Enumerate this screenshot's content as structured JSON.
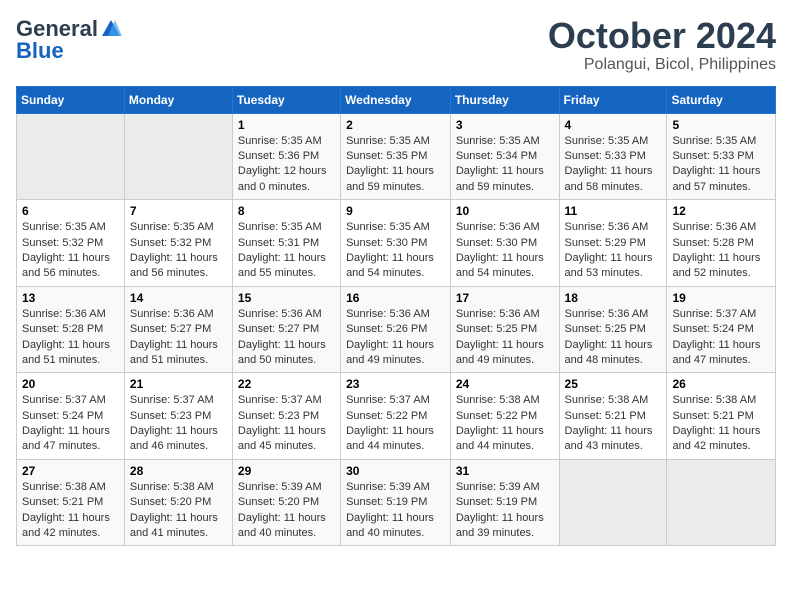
{
  "header": {
    "logo_general": "General",
    "logo_blue": "Blue",
    "month_title": "October 2024",
    "location": "Polangui, Bicol, Philippines"
  },
  "days_of_week": [
    "Sunday",
    "Monday",
    "Tuesday",
    "Wednesday",
    "Thursday",
    "Friday",
    "Saturday"
  ],
  "weeks": [
    [
      {
        "day": "",
        "sunrise": "",
        "sunset": "",
        "daylight": "",
        "empty": true
      },
      {
        "day": "",
        "sunrise": "",
        "sunset": "",
        "daylight": "",
        "empty": true
      },
      {
        "day": "1",
        "sunrise": "Sunrise: 5:35 AM",
        "sunset": "Sunset: 5:36 PM",
        "daylight": "Daylight: 12 hours and 0 minutes."
      },
      {
        "day": "2",
        "sunrise": "Sunrise: 5:35 AM",
        "sunset": "Sunset: 5:35 PM",
        "daylight": "Daylight: 11 hours and 59 minutes."
      },
      {
        "day": "3",
        "sunrise": "Sunrise: 5:35 AM",
        "sunset": "Sunset: 5:34 PM",
        "daylight": "Daylight: 11 hours and 59 minutes."
      },
      {
        "day": "4",
        "sunrise": "Sunrise: 5:35 AM",
        "sunset": "Sunset: 5:33 PM",
        "daylight": "Daylight: 11 hours and 58 minutes."
      },
      {
        "day": "5",
        "sunrise": "Sunrise: 5:35 AM",
        "sunset": "Sunset: 5:33 PM",
        "daylight": "Daylight: 11 hours and 57 minutes."
      }
    ],
    [
      {
        "day": "6",
        "sunrise": "Sunrise: 5:35 AM",
        "sunset": "Sunset: 5:32 PM",
        "daylight": "Daylight: 11 hours and 56 minutes."
      },
      {
        "day": "7",
        "sunrise": "Sunrise: 5:35 AM",
        "sunset": "Sunset: 5:32 PM",
        "daylight": "Daylight: 11 hours and 56 minutes."
      },
      {
        "day": "8",
        "sunrise": "Sunrise: 5:35 AM",
        "sunset": "Sunset: 5:31 PM",
        "daylight": "Daylight: 11 hours and 55 minutes."
      },
      {
        "day": "9",
        "sunrise": "Sunrise: 5:35 AM",
        "sunset": "Sunset: 5:30 PM",
        "daylight": "Daylight: 11 hours and 54 minutes."
      },
      {
        "day": "10",
        "sunrise": "Sunrise: 5:36 AM",
        "sunset": "Sunset: 5:30 PM",
        "daylight": "Daylight: 11 hours and 54 minutes."
      },
      {
        "day": "11",
        "sunrise": "Sunrise: 5:36 AM",
        "sunset": "Sunset: 5:29 PM",
        "daylight": "Daylight: 11 hours and 53 minutes."
      },
      {
        "day": "12",
        "sunrise": "Sunrise: 5:36 AM",
        "sunset": "Sunset: 5:28 PM",
        "daylight": "Daylight: 11 hours and 52 minutes."
      }
    ],
    [
      {
        "day": "13",
        "sunrise": "Sunrise: 5:36 AM",
        "sunset": "Sunset: 5:28 PM",
        "daylight": "Daylight: 11 hours and 51 minutes."
      },
      {
        "day": "14",
        "sunrise": "Sunrise: 5:36 AM",
        "sunset": "Sunset: 5:27 PM",
        "daylight": "Daylight: 11 hours and 51 minutes."
      },
      {
        "day": "15",
        "sunrise": "Sunrise: 5:36 AM",
        "sunset": "Sunset: 5:27 PM",
        "daylight": "Daylight: 11 hours and 50 minutes."
      },
      {
        "day": "16",
        "sunrise": "Sunrise: 5:36 AM",
        "sunset": "Sunset: 5:26 PM",
        "daylight": "Daylight: 11 hours and 49 minutes."
      },
      {
        "day": "17",
        "sunrise": "Sunrise: 5:36 AM",
        "sunset": "Sunset: 5:25 PM",
        "daylight": "Daylight: 11 hours and 49 minutes."
      },
      {
        "day": "18",
        "sunrise": "Sunrise: 5:36 AM",
        "sunset": "Sunset: 5:25 PM",
        "daylight": "Daylight: 11 hours and 48 minutes."
      },
      {
        "day": "19",
        "sunrise": "Sunrise: 5:37 AM",
        "sunset": "Sunset: 5:24 PM",
        "daylight": "Daylight: 11 hours and 47 minutes."
      }
    ],
    [
      {
        "day": "20",
        "sunrise": "Sunrise: 5:37 AM",
        "sunset": "Sunset: 5:24 PM",
        "daylight": "Daylight: 11 hours and 47 minutes."
      },
      {
        "day": "21",
        "sunrise": "Sunrise: 5:37 AM",
        "sunset": "Sunset: 5:23 PM",
        "daylight": "Daylight: 11 hours and 46 minutes."
      },
      {
        "day": "22",
        "sunrise": "Sunrise: 5:37 AM",
        "sunset": "Sunset: 5:23 PM",
        "daylight": "Daylight: 11 hours and 45 minutes."
      },
      {
        "day": "23",
        "sunrise": "Sunrise: 5:37 AM",
        "sunset": "Sunset: 5:22 PM",
        "daylight": "Daylight: 11 hours and 44 minutes."
      },
      {
        "day": "24",
        "sunrise": "Sunrise: 5:38 AM",
        "sunset": "Sunset: 5:22 PM",
        "daylight": "Daylight: 11 hours and 44 minutes."
      },
      {
        "day": "25",
        "sunrise": "Sunrise: 5:38 AM",
        "sunset": "Sunset: 5:21 PM",
        "daylight": "Daylight: 11 hours and 43 minutes."
      },
      {
        "day": "26",
        "sunrise": "Sunrise: 5:38 AM",
        "sunset": "Sunset: 5:21 PM",
        "daylight": "Daylight: 11 hours and 42 minutes."
      }
    ],
    [
      {
        "day": "27",
        "sunrise": "Sunrise: 5:38 AM",
        "sunset": "Sunset: 5:21 PM",
        "daylight": "Daylight: 11 hours and 42 minutes."
      },
      {
        "day": "28",
        "sunrise": "Sunrise: 5:38 AM",
        "sunset": "Sunset: 5:20 PM",
        "daylight": "Daylight: 11 hours and 41 minutes."
      },
      {
        "day": "29",
        "sunrise": "Sunrise: 5:39 AM",
        "sunset": "Sunset: 5:20 PM",
        "daylight": "Daylight: 11 hours and 40 minutes."
      },
      {
        "day": "30",
        "sunrise": "Sunrise: 5:39 AM",
        "sunset": "Sunset: 5:19 PM",
        "daylight": "Daylight: 11 hours and 40 minutes."
      },
      {
        "day": "31",
        "sunrise": "Sunrise: 5:39 AM",
        "sunset": "Sunset: 5:19 PM",
        "daylight": "Daylight: 11 hours and 39 minutes."
      },
      {
        "day": "",
        "sunrise": "",
        "sunset": "",
        "daylight": "",
        "empty": true
      },
      {
        "day": "",
        "sunrise": "",
        "sunset": "",
        "daylight": "",
        "empty": true
      }
    ]
  ]
}
